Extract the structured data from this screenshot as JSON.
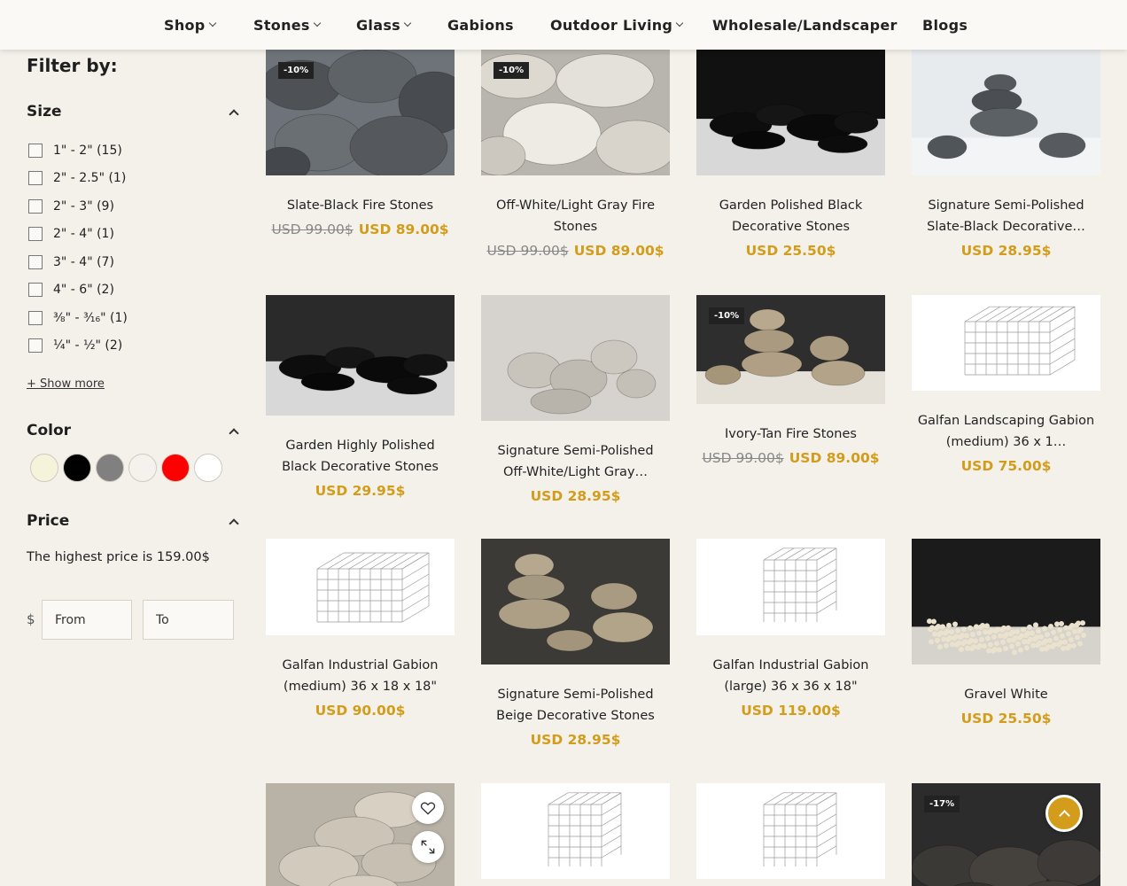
{
  "nav": [
    {
      "label": "Shop",
      "dropdown": true
    },
    {
      "label": "Stones",
      "dropdown": true
    },
    {
      "label": "Glass",
      "dropdown": true
    },
    {
      "label": "Gabions",
      "dropdown": false
    },
    {
      "label": "Outdoor Living",
      "dropdown": true
    },
    {
      "label": "Wholesale/Landscaper",
      "dropdown": false
    },
    {
      "label": "Blogs",
      "dropdown": false
    }
  ],
  "filter": {
    "title": "Filter by:",
    "size": {
      "label": "Size",
      "options": [
        "1\" - 2\" (15)",
        "2\" - 2.5\" (1)",
        "2\" - 3\" (9)",
        "2\" - 4\" (1)",
        "3\" - 4\" (7)",
        "4\" - 6\" (2)",
        "⅜\" - ³⁄₁₆\" (1)",
        "¼\" - ½\" (2)"
      ],
      "show_more": "+ Show more"
    },
    "color": {
      "label": "Color",
      "swatches": [
        "#f5f3d9",
        "#000000",
        "#808080",
        "#f5f2ee",
        "#ff0000",
        "#ffffff"
      ]
    },
    "price": {
      "label": "Price",
      "note": "The highest price is 159.00$",
      "currency": "$",
      "from_placeholder": "From",
      "to_placeholder": "To"
    }
  },
  "products": [
    {
      "name": "Slate-Black Fire Stones",
      "old_price": "USD 99.00$",
      "price": "USD 89.00$",
      "badge": "-10%",
      "image": "grey-stones"
    },
    {
      "name": "Off-White/Light Gray Fire Stones",
      "old_price": "USD 99.00$",
      "price": "USD 89.00$",
      "badge": "-10%",
      "image": "white-stones"
    },
    {
      "name": "Garden Polished Black Decorative Stones",
      "old_price": "",
      "price": "USD 25.50$",
      "badge": "",
      "image": "black-polished"
    },
    {
      "name": "Signature Semi-Polished Slate-Black Decorative…",
      "old_price": "",
      "price": "USD 28.95$",
      "badge": "",
      "image": "slate-stack"
    },
    {
      "name": "Garden Highly Polished Black Decorative Stones",
      "old_price": "",
      "price": "USD 29.95$",
      "badge": "",
      "image": "black-polished-2"
    },
    {
      "name": "Signature Semi-Polished Off-White/Light Gray…",
      "old_price": "",
      "price": "USD 28.95$",
      "badge": "",
      "image": "offwhite-group"
    },
    {
      "name": "Ivory-Tan Fire Stones",
      "old_price": "USD 99.00$",
      "price": "USD 89.00$",
      "badge": "-10%",
      "image": "tan-stack"
    },
    {
      "name": "Galfan Landscaping Gabion (medium) 36 x 1…",
      "old_price": "",
      "price": "USD 75.00$",
      "badge": "",
      "image": "gabion-wide"
    },
    {
      "name": "Galfan Industrial Gabion (medium) 36 x 18 x 18\"",
      "old_price": "",
      "price": "USD 90.00$",
      "badge": "",
      "image": "gabion-medium"
    },
    {
      "name": "Signature Semi-Polished Beige Decorative Stones",
      "old_price": "",
      "price": "USD 28.95$",
      "badge": "",
      "image": "beige-stack"
    },
    {
      "name": "Galfan Industrial Gabion (large) 36 x 36 x 18\"",
      "old_price": "",
      "price": "USD 119.00$",
      "badge": "",
      "image": "gabion-tall"
    },
    {
      "name": "Gravel White",
      "old_price": "",
      "price": "USD 25.50$",
      "badge": "",
      "image": "gravel"
    },
    {
      "name": "",
      "old_price": "",
      "price": "",
      "badge": "",
      "image": "beige-pile"
    },
    {
      "name": "",
      "old_price": "",
      "price": "",
      "badge": "",
      "image": "gabion-tall"
    },
    {
      "name": "",
      "old_price": "",
      "price": "",
      "badge": "",
      "image": "gabion-tall"
    },
    {
      "name": "",
      "old_price": "",
      "price": "",
      "badge": "-17%",
      "image": "lava-stones"
    }
  ],
  "actions": {
    "wishlist_icon": "heart-icon",
    "quickview_icon": "expand-icon",
    "back_to_top_icon": "chevron-up-icon"
  }
}
